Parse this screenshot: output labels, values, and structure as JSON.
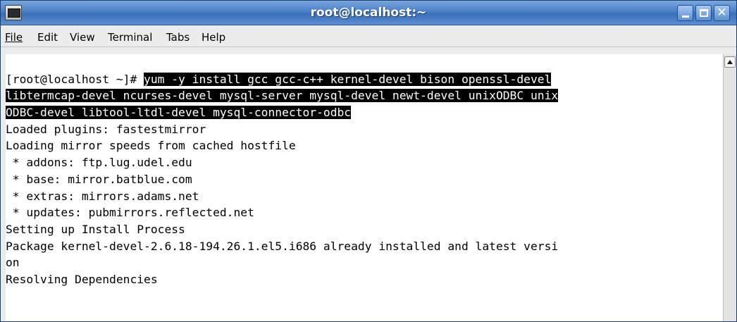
{
  "window": {
    "title": "root@localhost:~",
    "accent": "#4a80c8"
  },
  "icons": {
    "app": "terminal-icon",
    "minimize": "minimize-icon",
    "maximize": "maximize-icon",
    "close": "close-icon",
    "scroll_up": "arrow-up-icon"
  },
  "menu": {
    "file": "File",
    "edit": "Edit",
    "view": "View",
    "terminal": "Terminal",
    "tabs": "Tabs",
    "help": "Help"
  },
  "terminal": {
    "prompt": "[root@localhost ~]# ",
    "command_line1": "yum -y install gcc gcc-c++ kernel-devel bison openssl-devel",
    "command_line2": "libtermcap-devel ncurses-devel mysql-server mysql-devel newt-devel unixODBC unix",
    "command_line3": "ODBC-devel libtool-ltdl-devel mysql-connector-odbc",
    "output": [
      "Loaded plugins: fastestmirror",
      "Loading mirror speeds from cached hostfile",
      " * addons: ftp.lug.udel.edu",
      " * base: mirror.batblue.com",
      " * extras: mirrors.adams.net",
      " * updates: pubmirrors.reflected.net",
      "Setting up Install Process",
      "Package kernel-devel-2.6.18-194.26.1.el5.i686 already installed and latest versi",
      "on",
      "Resolving Dependencies"
    ],
    "selection_color": "#000000"
  }
}
